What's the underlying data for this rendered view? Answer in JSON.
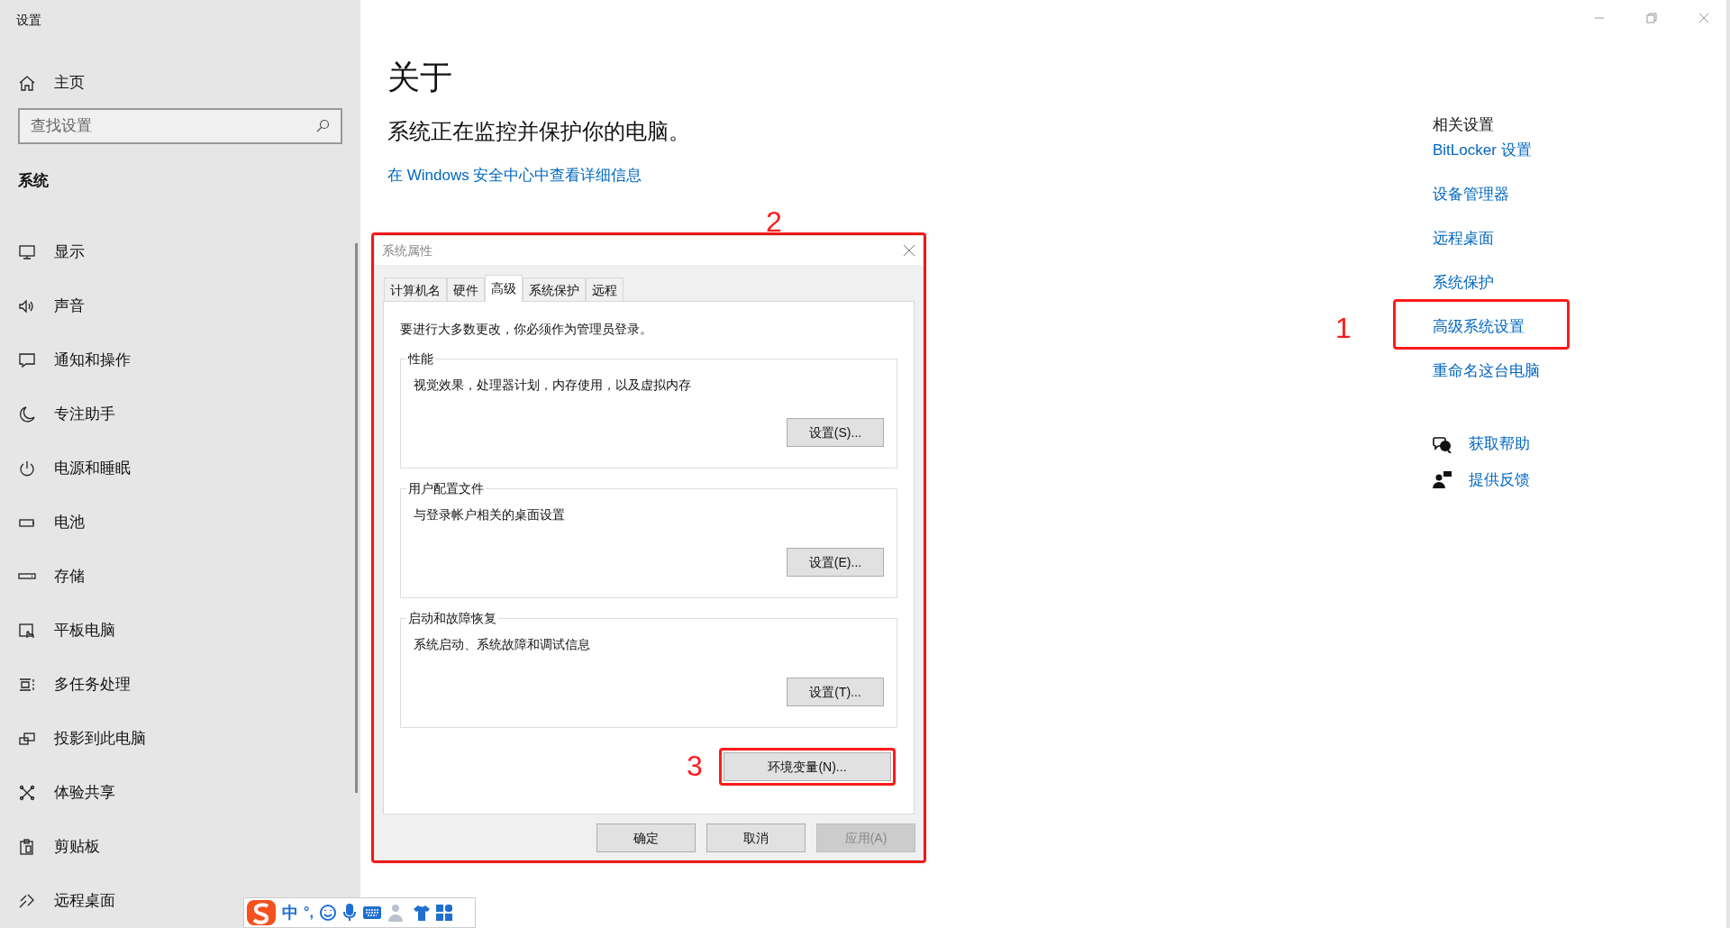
{
  "window": {
    "title": "设置"
  },
  "sidebar": {
    "home": "主页",
    "search": {
      "placeholder": "查找设置"
    },
    "section": "系统",
    "items": [
      {
        "label": "显示",
        "kind": "monitor"
      },
      {
        "label": "声音",
        "kind": "speaker"
      },
      {
        "label": "通知和操作",
        "kind": "message"
      },
      {
        "label": "专注助手",
        "kind": "moon"
      },
      {
        "label": "电源和睡眠",
        "kind": "power"
      },
      {
        "label": "电池",
        "kind": "battery"
      },
      {
        "label": "存储",
        "kind": "storage"
      },
      {
        "label": "平板电脑",
        "kind": "tablet"
      },
      {
        "label": "多任务处理",
        "kind": "multitask"
      },
      {
        "label": "投影到此电脑",
        "kind": "project"
      },
      {
        "label": "体验共享",
        "kind": "share"
      },
      {
        "label": "剪贴板",
        "kind": "clipboard"
      },
      {
        "label": "远程桌面",
        "kind": "remote"
      }
    ]
  },
  "main": {
    "title": "关于",
    "subtitle": "系统正在监控并保护你的电脑。",
    "link": "在 Windows 安全中心中查看详细信息"
  },
  "related": {
    "heading": "相关设置",
    "links": [
      {
        "label": "BitLocker 设置"
      },
      {
        "label": "设备管理器"
      },
      {
        "label": "远程桌面"
      },
      {
        "label": "系统保护"
      },
      {
        "label": "高级系统设置",
        "highlighted": true
      },
      {
        "label": "重命名这台电脑"
      }
    ],
    "help": [
      {
        "label": "获取帮助",
        "kind": "help"
      },
      {
        "label": "提供反馈",
        "kind": "feedback"
      }
    ]
  },
  "annotations": [
    "1",
    "2",
    "3"
  ],
  "dialog": {
    "title": "系统属性",
    "tabs": [
      {
        "label": "计算机名",
        "selected": false
      },
      {
        "label": "硬件",
        "selected": false
      },
      {
        "label": "高级",
        "selected": true
      },
      {
        "label": "系统保护",
        "selected": false
      },
      {
        "label": "远程",
        "selected": false
      }
    ],
    "notice": "要进行大多数更改，你必须作为管理员登录。",
    "groups": [
      {
        "title": "性能",
        "description": "视觉效果，处理器计划，内存使用，以及虚拟内存",
        "button": "设置(S)..."
      },
      {
        "title": "用户配置文件",
        "description": "与登录帐户相关的桌面设置",
        "button": "设置(E)..."
      },
      {
        "title": "启动和故障恢复",
        "description": "系统启动、系统故障和调试信息",
        "button": "设置(T)..."
      }
    ],
    "env_button": "环境变量(N)...",
    "buttons": [
      {
        "label": "确定",
        "disabled": false
      },
      {
        "label": "取消",
        "disabled": false
      },
      {
        "label": "应用(A)",
        "disabled": true
      }
    ]
  },
  "ime_bar": {
    "mode": "中",
    "punct": "°,"
  }
}
